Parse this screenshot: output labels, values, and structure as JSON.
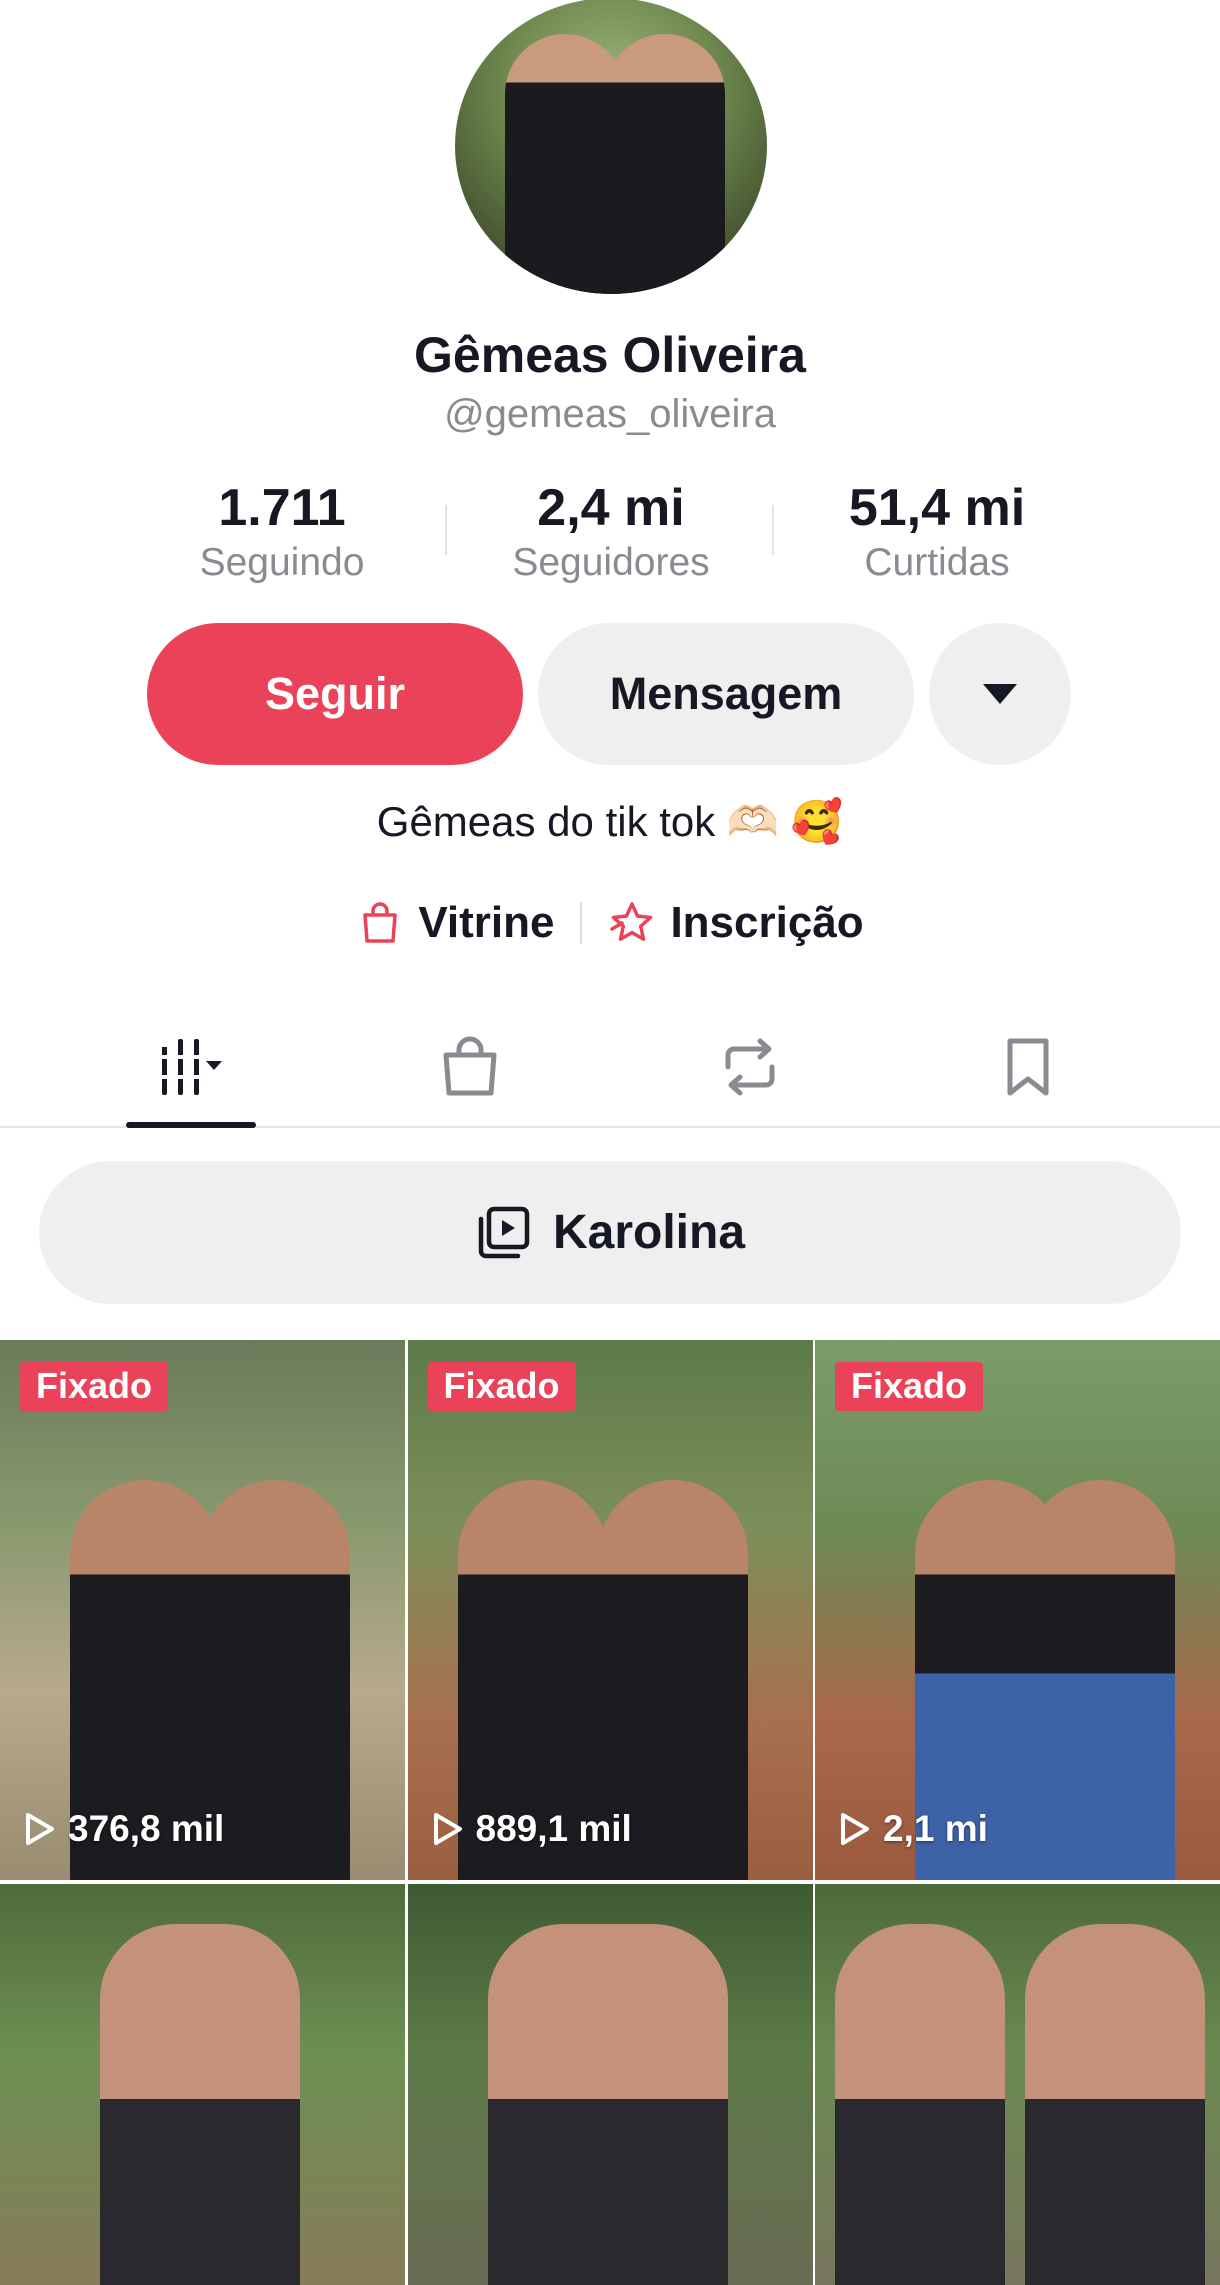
{
  "profile": {
    "display_name": "Gêmeas Oliveira",
    "handle": "@gemeas_oliveira",
    "bio": "Gêmeas do tik tok 🫶🏻 🥰"
  },
  "stats": [
    {
      "value": "1.711",
      "label": "Seguindo"
    },
    {
      "value": "2,4 mi",
      "label": "Seguidores"
    },
    {
      "value": "51,4 mi",
      "label": "Curtidas"
    }
  ],
  "actions": {
    "follow_label": "Seguir",
    "message_label": "Mensagem",
    "more_icon": "caret-down-icon"
  },
  "links": [
    {
      "label": "Vitrine",
      "icon": "shopping-bag-icon"
    },
    {
      "label": "Inscrição",
      "icon": "subscription-star-icon"
    }
  ],
  "tabs": [
    {
      "icon": "videos-grid-icon",
      "active": true
    },
    {
      "icon": "shop-bag-icon",
      "active": false
    },
    {
      "icon": "repost-icon",
      "active": false
    },
    {
      "icon": "bookmark-icon",
      "active": false
    }
  ],
  "playlist": {
    "label": "Karolina",
    "icon": "playlist-icon"
  },
  "videos": [
    {
      "badge": "Fixado",
      "views": "376,8 mil"
    },
    {
      "badge": "Fixado",
      "views": "889,1 mil"
    },
    {
      "badge": "Fixado",
      "views": "2,1 mi"
    },
    {
      "badge": "",
      "views": ""
    },
    {
      "badge": "",
      "views": ""
    },
    {
      "badge": "",
      "views": ""
    }
  ],
  "colors": {
    "accent": "#ea4359",
    "secondary_button": "#efeff0",
    "muted_text": "#8a8b91"
  }
}
